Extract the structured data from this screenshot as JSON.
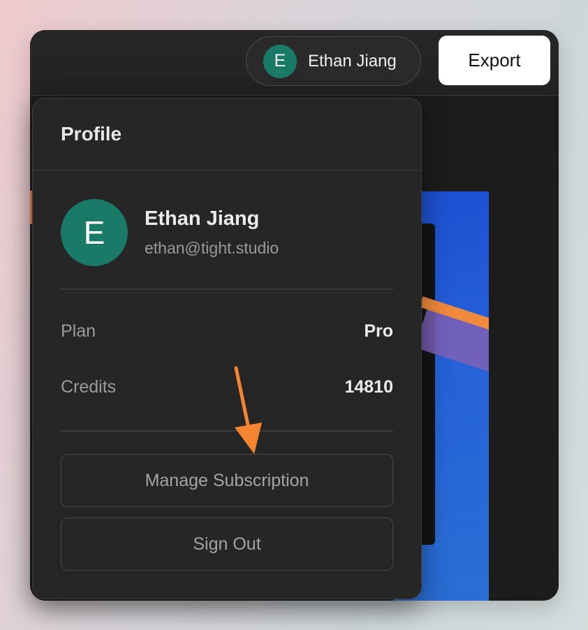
{
  "topbar": {
    "user_pill": {
      "avatar_initial": "E",
      "name": "Ethan Jiang"
    },
    "export_label": "Export"
  },
  "profile": {
    "title": "Profile",
    "avatar_initial": "E",
    "name": "Ethan Jiang",
    "email": "ethan@tight.studio",
    "stats": [
      {
        "label": "Plan",
        "value": "Pro"
      },
      {
        "label": "Credits",
        "value": "14810"
      }
    ],
    "manage_label": "Manage Subscription",
    "signout_label": "Sign Out"
  },
  "colors": {
    "avatar": "#1a7a68",
    "annotation_arrow": "#f5862f",
    "panel_bg": "#262626"
  },
  "icons": {
    "annotation": "arrow-down-icon"
  }
}
